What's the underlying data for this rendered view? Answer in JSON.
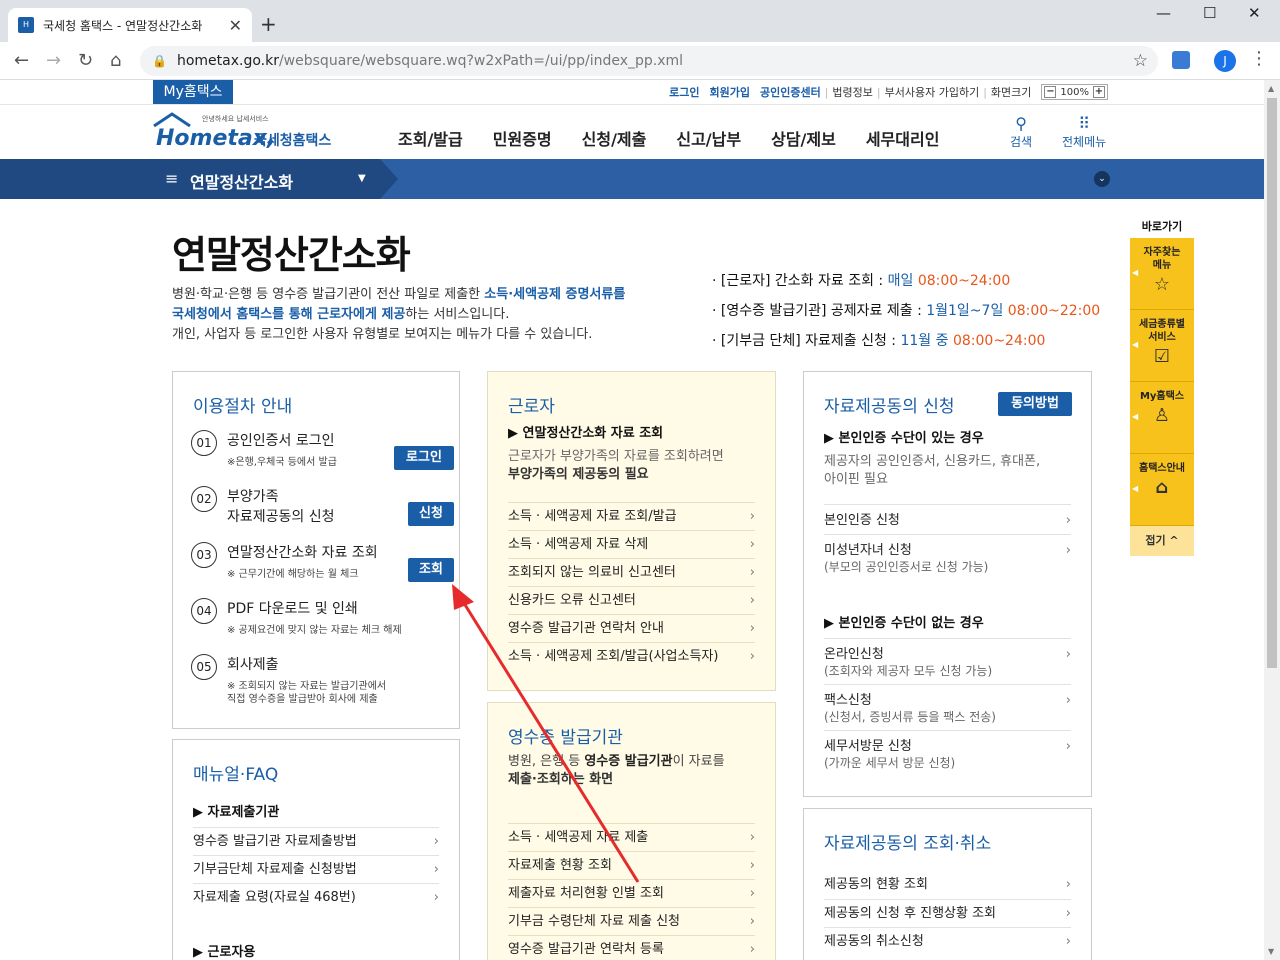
{
  "browser": {
    "tab_title": "국세청 홈택스 - 연말정산간소화",
    "tab_close": "✕",
    "new_tab": "+",
    "url_host": "hometax.go.kr",
    "url_path": "/websquare/websquare.wq?w2xPath=/ui/pp/index_pp.xml",
    "profile_initial": "J"
  },
  "header": {
    "my_hometax": "My홈택스",
    "util": {
      "login": "로그인",
      "join": "회원가입",
      "cert": "공인인증센터",
      "law": "법령정보",
      "nonresident": "부서사용자 가입하기",
      "screen": "화면크기",
      "zoom": "100%"
    },
    "logo_small": "안녕하세요 납세서비스",
    "logo_main": "Hometax,",
    "logo_sub": "국세청홈택스",
    "gnb": [
      "조회/발급",
      "민원증명",
      "신청/제출",
      "신고/납부",
      "상담/제보",
      "세무대리인"
    ],
    "search_label": "검색",
    "allmenu_label": "전체메뉴"
  },
  "subbar": {
    "title": "연말정산간소화"
  },
  "page": {
    "title": "연말정산간소화",
    "desc": {
      "line1_a": "병원·학교·은행 등 영수증 발급기관이 전산 파일로 제출한 ",
      "line1_b": "소득·세액공제 증명서류를",
      "line2_a": "국세청에서 홈택스를 통해 근로자에게 제공",
      "line2_b": "하는 서비스입니다.",
      "line3": "개인, 사업자 등 로그인한 사용자 유형별로 보여지는 메뉴가 다를 수 있습니다."
    },
    "schedule": [
      {
        "who": "· [근로자] 간소화 자료 조회 : ",
        "when": "매일 ",
        "time": "08:00~24:00"
      },
      {
        "who": "· [영수증 발급기관] 공제자료 제출 : ",
        "when": "1월1일~7일 ",
        "time": "08:00~22:00"
      },
      {
        "who": "· [기부금 단체] 자료제출 신청 : ",
        "when": "11월 중 ",
        "time": "08:00~24:00"
      }
    ]
  },
  "procedure": {
    "title": "이용절차 안내",
    "steps": [
      {
        "num": "01",
        "title": "공인인증서 로그인",
        "note": "※은행,우체국 등에서 발급",
        "btn": "로그인"
      },
      {
        "num": "02",
        "title": "부양가족",
        "title2": "자료제공동의 신청",
        "btn": "신청"
      },
      {
        "num": "03",
        "title": "연말정산간소화 자료 조회",
        "note": "※ 근무기간에 해당하는 월 체크",
        "btn": "조회"
      },
      {
        "num": "04",
        "title": "PDF 다운로드 및 인쇄",
        "note": "※ 공제요건에 맞지 않는 자료는 체크 해제"
      },
      {
        "num": "05",
        "title": "회사제출",
        "note": "※ 조회되지 않는 자료는 발급기관에서",
        "note2": "직접 영수증을 발급받아 회사에 제출"
      }
    ]
  },
  "manual": {
    "title": "매뉴얼·FAQ",
    "sub": "▶ 자료제출기관",
    "links": [
      "영수증 발급기관 자료제출방법",
      "기부금단체 자료제출 신청방법",
      "자료제출 요령(자료실 468번)"
    ],
    "sub2": "▶ 근로자용"
  },
  "worker": {
    "title": "근로자",
    "sub": "▶ 연말정산간소화 자료 조회",
    "desc1": "근로자가 부양가족의 자료를 조회하려면",
    "desc2": "부양가족의 제공동의 필요",
    "links": [
      "소득 · 세액공제 자료 조회/발급",
      "소득 · 세액공제 자료 삭제",
      "조회되지 않는 의료비 신고센터",
      "신용카드 오류 신고센터",
      "영수증 발급기관 연락처 안내",
      "소득 · 세액공제 조회/발급(사업소득자)"
    ]
  },
  "issuer": {
    "title": "영수증 발급기관",
    "desc1_a": "병원, 은행 등 ",
    "desc1_b": "영수증 발급기관",
    "desc1_c": "이 자료를",
    "desc2": "제출·조회하는 화면",
    "links": [
      "소득 · 세액공제 자료 제출",
      "자료제출 현황 조회",
      "제출자료 처리현황 인별 조회",
      "기부금 수령단체 자료 제출 신청",
      "영수증 발급기관 연락처 등록"
    ]
  },
  "consent": {
    "title": "자료제공동의 신청",
    "btn": "동의방법",
    "sub1": "▶ 본인인증 수단이 있는 경우",
    "gray1": "제공자의 공인인증서, 신용카드, 휴대폰,",
    "gray2": "아이핀 필요",
    "links1": [
      {
        "t": "본인인증 신청",
        "s": ""
      },
      {
        "t": "미성년자녀 신청",
        "s": "(부모의 공인인증서로 신청 가능)"
      }
    ],
    "sub2": "▶ 본인인증 수단이 없는 경우",
    "links2": [
      {
        "t": "온라인신청",
        "s": "(조회자와 제공자 모두 신청 가능)"
      },
      {
        "t": "팩스신청",
        "s": "(신청서, 증빙서류 등을 팩스 전송)"
      },
      {
        "t": "세무서방문 신청",
        "s": "(가까운 세무서 방문 신청)"
      }
    ]
  },
  "consent_view": {
    "title": "자료제공동의 조회·취소",
    "links": [
      "제공동의 현황 조회",
      "제공동의 신청 후 진행상황 조회",
      "제공동의 취소신청"
    ]
  },
  "quick": {
    "header": "바로가기",
    "items": [
      {
        "l1": "자주찾는",
        "l2": "메뉴",
        "icon": "☆"
      },
      {
        "l1": "세금종류별",
        "l2": "서비스",
        "icon": "☑"
      },
      {
        "l1": "My홈택스",
        "l2": "",
        "icon": "♙"
      },
      {
        "l1": "홈택스안내",
        "l2": "",
        "icon": "⌂"
      }
    ],
    "close": "접기 ^"
  },
  "arrow_mark": "›",
  "colors": {
    "brand": "#1a5ea8",
    "accent_time": "#e8561a",
    "quick": "#f8c21c",
    "annotation": "#e52b2b"
  }
}
